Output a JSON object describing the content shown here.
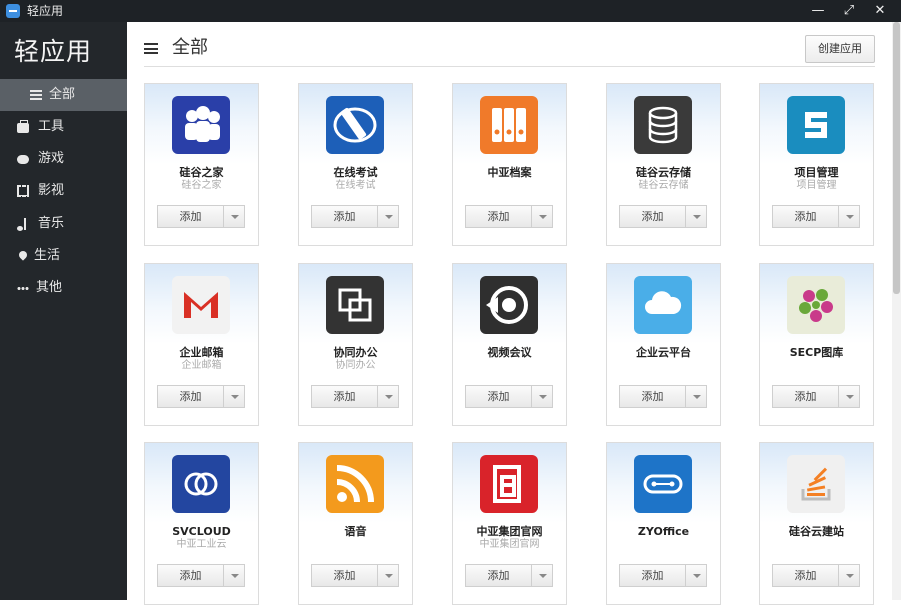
{
  "window": {
    "title": "轻应用",
    "controls": [
      "—",
      "⤢",
      "✕"
    ]
  },
  "sidebar": {
    "brand": "轻应用",
    "items": [
      {
        "label": "全部",
        "icon": "menu-icon",
        "active": true
      },
      {
        "label": "工具",
        "icon": "briefcase-icon"
      },
      {
        "label": "游戏",
        "icon": "gamepad-icon"
      },
      {
        "label": "影视",
        "icon": "film-icon"
      },
      {
        "label": "音乐",
        "icon": "music-icon"
      },
      {
        "label": "生活",
        "icon": "map-pin-icon"
      },
      {
        "label": "其他",
        "icon": "more-icon"
      }
    ]
  },
  "main": {
    "heading": "全部",
    "create_button": "创建应用",
    "apps": [
      {
        "name": "硅谷之家",
        "subtitle": "硅谷之家",
        "icon": "people-icon",
        "color": "#2a3fa8"
      },
      {
        "name": "在线考试",
        "subtitle": "在线考试",
        "icon": "pen-icon",
        "color": "#1d5fb8"
      },
      {
        "name": "中亚档案",
        "subtitle": "",
        "icon": "binders-icon",
        "color": "#f07a2a"
      },
      {
        "name": "硅谷云存储",
        "subtitle": "硅谷云存储",
        "icon": "database-icon",
        "color": "#3a3a3a"
      },
      {
        "name": "项目管理",
        "subtitle": "项目管理",
        "icon": "s-logo-icon",
        "color": "#1a8dbf"
      },
      {
        "name": "企业邮箱",
        "subtitle": "企业邮箱",
        "icon": "gmail-icon",
        "color": "#f2f2f2"
      },
      {
        "name": "协同办公",
        "subtitle": "协同办公",
        "icon": "overlap-squares-icon",
        "color": "#333333"
      },
      {
        "name": "视频会议",
        "subtitle": "",
        "icon": "video-play-icon",
        "color": "#2f2f2f"
      },
      {
        "name": "企业云平台",
        "subtitle": "",
        "icon": "cloud-icon",
        "color": "#4aaee8"
      },
      {
        "name": "SECP图库",
        "subtitle": "",
        "icon": "flower-icon",
        "color": "#e9ecd9"
      },
      {
        "name": "SVCLOUD",
        "subtitle": "中亚工业云",
        "icon": "link-circles-icon",
        "color": "#2346a0"
      },
      {
        "name": "语音",
        "subtitle": "",
        "icon": "rss-icon",
        "color": "#f39a1d"
      },
      {
        "name": "中亚集团官网",
        "subtitle": "中亚集团官网",
        "icon": "brand-a-icon",
        "color": "#d9232a"
      },
      {
        "name": "ZYOffice",
        "subtitle": "",
        "icon": "dots-box-icon",
        "color": "#1e74c8"
      },
      {
        "name": "硅谷云建站",
        "subtitle": "",
        "icon": "stack-icon",
        "color": "#f0f0f0"
      }
    ],
    "add_label": "添加"
  }
}
